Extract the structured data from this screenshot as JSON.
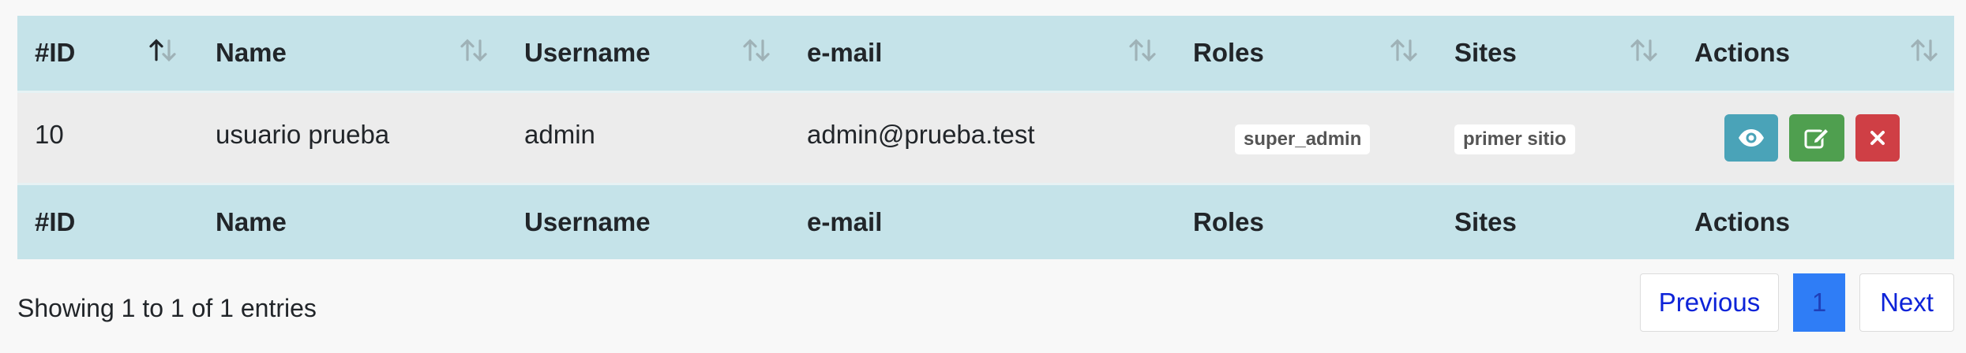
{
  "table": {
    "columns": [
      {
        "label": "#ID",
        "sort": "asc"
      },
      {
        "label": "Name",
        "sort": "none"
      },
      {
        "label": "Username",
        "sort": "none"
      },
      {
        "label": "e-mail",
        "sort": "none"
      },
      {
        "label": "Roles",
        "sort": "none"
      },
      {
        "label": "Sites",
        "sort": "none"
      },
      {
        "label": "Actions",
        "sort": "none"
      }
    ],
    "rows": [
      {
        "id": "10",
        "name": "usuario prueba",
        "username": "admin",
        "email": "admin@prueba.test",
        "role": "super_admin",
        "site": "primer sitio"
      }
    ]
  },
  "icons": {
    "sort": "sort-arrows-icon",
    "view": "eye-icon",
    "edit": "edit-icon",
    "delete": "close-icon"
  },
  "colors": {
    "header_bg": "#c5e3e9",
    "row_bg": "#ececec",
    "view_btn": "#4aa3b8",
    "edit_btn": "#4f9f4f",
    "delete_btn": "#cf3f45",
    "page_active": "#2f7df6"
  },
  "footer": {
    "info": "Showing 1 to 1 of 1 entries",
    "pagination": {
      "previous": "Previous",
      "current": "1",
      "next": "Next"
    }
  }
}
